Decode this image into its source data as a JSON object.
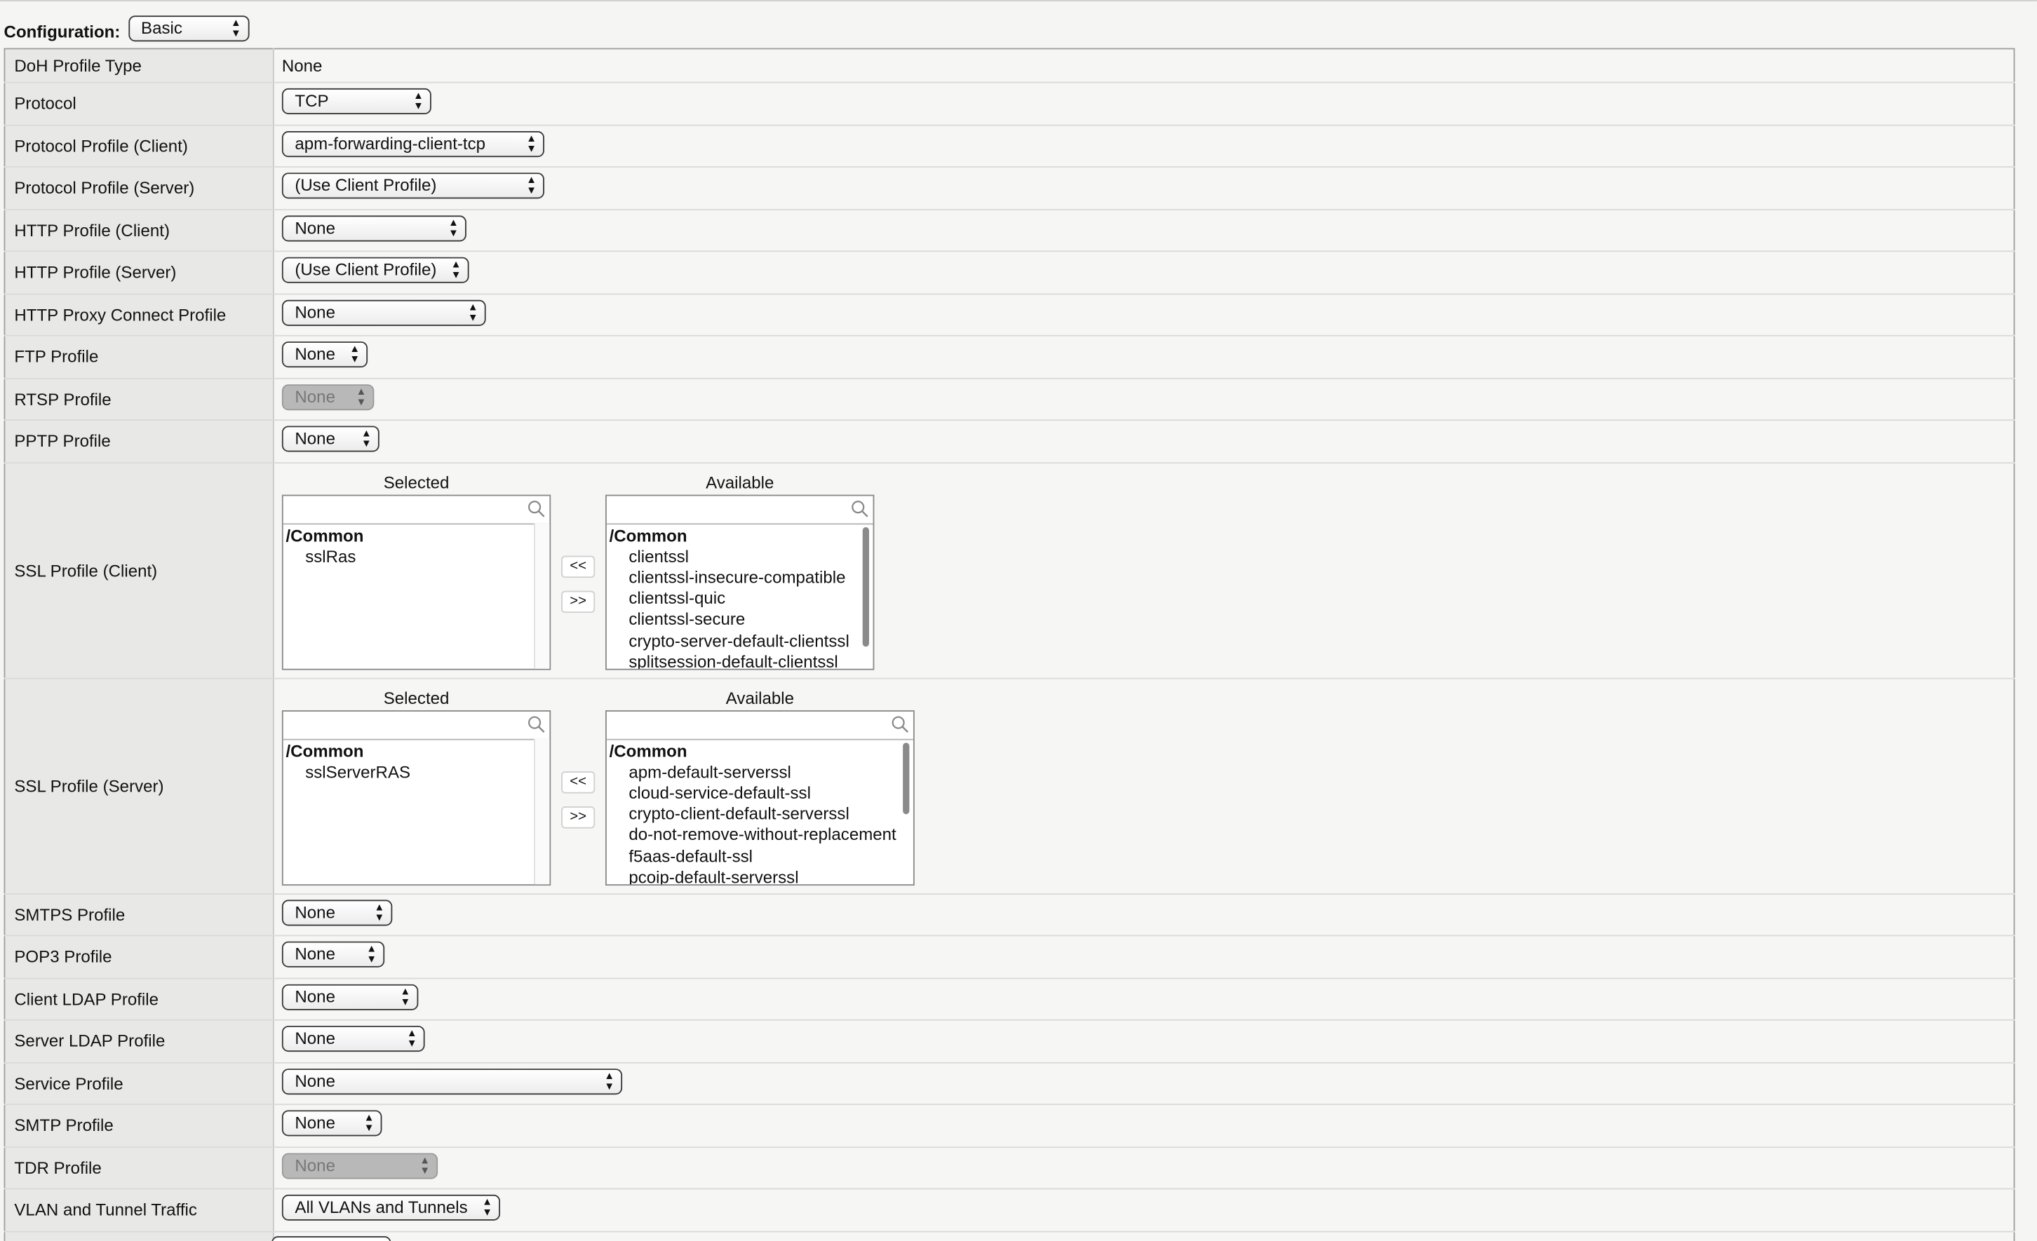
{
  "configuration": {
    "label": "Configuration:",
    "value": "Basic"
  },
  "rows": {
    "doh_profile_type": {
      "label": "DoH Profile Type",
      "value": "None"
    },
    "protocol": {
      "label": "Protocol",
      "value": "TCP"
    },
    "protocol_profile_client": {
      "label": "Protocol Profile (Client)",
      "value": "apm-forwarding-client-tcp"
    },
    "protocol_profile_server": {
      "label": "Protocol Profile (Server)",
      "value": "(Use Client Profile)"
    },
    "http_profile_client": {
      "label": "HTTP Profile (Client)",
      "value": "None"
    },
    "http_profile_server": {
      "label": "HTTP Profile (Server)",
      "value": "(Use Client Profile)"
    },
    "http_proxy_connect_profile": {
      "label": "HTTP Proxy Connect Profile",
      "value": "None"
    },
    "ftp_profile": {
      "label": "FTP Profile",
      "value": "None"
    },
    "rtsp_profile": {
      "label": "RTSP Profile",
      "value": "None"
    },
    "pptp_profile": {
      "label": "PPTP Profile",
      "value": "None"
    },
    "smtps_profile": {
      "label": "SMTPS Profile",
      "value": "None"
    },
    "pop3_profile": {
      "label": "POP3 Profile",
      "value": "None"
    },
    "client_ldap_profile": {
      "label": "Client LDAP Profile",
      "value": "None"
    },
    "server_ldap_profile": {
      "label": "Server LDAP Profile",
      "value": "None"
    },
    "service_profile": {
      "label": "Service Profile",
      "value": "None"
    },
    "smtp_profile": {
      "label": "SMTP Profile",
      "value": "None"
    },
    "tdr_profile": {
      "label": "TDR Profile",
      "value": "None"
    },
    "vlan_tunnel_traffic": {
      "label": "VLAN and Tunnel Traffic",
      "value": "All VLANs and Tunnels"
    }
  },
  "ssl_client": {
    "label": "SSL Profile (Client)",
    "selected_header": "Selected",
    "available_header": "Available",
    "selected_group": "/Common",
    "selected_items": [
      "sslRas"
    ],
    "available_group": "/Common",
    "available_items": [
      "clientssl",
      "clientssl-insecure-compatible",
      "clientssl-quic",
      "clientssl-secure",
      "crypto-server-default-clientssl",
      "splitsession-default-clientssl"
    ]
  },
  "ssl_server": {
    "label": "SSL Profile (Server)",
    "selected_header": "Selected",
    "available_header": "Available",
    "selected_group": "/Common",
    "selected_items": [
      "sslServerRAS"
    ],
    "available_group": "/Common",
    "available_items": [
      "apm-default-serverssl",
      "cloud-service-default-ssl",
      "crypto-client-default-serverssl",
      "do-not-remove-without-replacement",
      "f5aas-default-ssl",
      "pcoip-default-serverssl"
    ]
  },
  "buttons": {
    "move_left": "<<",
    "move_right": ">>"
  },
  "icons": {
    "search": "search-icon",
    "select_arrow": "up-down-arrows-icon"
  },
  "colors": {
    "label_bg": "#e8e8e6",
    "value_bg": "#f6f6f4",
    "disabled_select": "#b8b8b8"
  }
}
